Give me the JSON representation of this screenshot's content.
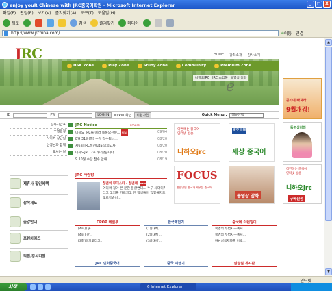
{
  "window": {
    "title": "enJoy youR Chinese with JRC중국어학원 - Microsoft Internet Explorer",
    "minimize": "_",
    "maximize": "□",
    "close": "X"
  },
  "menubar": {
    "items": [
      "파일(F)",
      "편집(E)",
      "보기(V)",
      "즐겨찾기(A)",
      "도구(T)",
      "도움말(H)"
    ]
  },
  "toolbar": {
    "back_label": "뒤로",
    "search_label": "검색",
    "favorites_label": "즐겨찾기",
    "media_label": "미디어"
  },
  "addressbar": {
    "url": "http://www.jrchina.com/",
    "go_label": "이동",
    "links_label": "연결"
  },
  "page": {
    "logo": {
      "j": "J",
      "rc": "RC",
      "sub": "JONGRO CHINA"
    },
    "toplinks": [
      "HOME",
      "강좌소개",
      "강사소개"
    ],
    "nav": [
      "HSK Zone",
      "Play Zone",
      "Study Zone",
      "Community",
      "Premium Zone"
    ],
    "subnav": [
      "니하오JRC",
      "JRC 소임풍",
      "동영상 강좌"
    ],
    "bigE": "e",
    "rightad1": {
      "line1": "공가에 빠져라!",
      "line2": "9월개강!"
    },
    "login": {
      "id_label": "ID",
      "pw_label": "PW",
      "log_label": "LOG",
      "in_label": "IN",
      "find_label": "ID/PW 확인",
      "join_label": "회원가입",
      "quick_label": "Quick Menu :",
      "quick_select": "메뉴선택"
    },
    "leftmenu": [
      "강좌시간표",
      "수업일정",
      "사이버 상담실",
      "선생님과 함께",
      "오시는 길"
    ],
    "sidebuttons": [
      "제휴사 할인혜택",
      "장학제도",
      "출강안내",
      "프렌차이즈",
      "직원/강사지원"
    ],
    "notice": {
      "title": "JRC Notice",
      "more": "+more",
      "new_label": "NEW",
      "items": [
        {
          "text": "니하오 JRC를 여러 동문으신분...",
          "date": "09/04"
        },
        {
          "text": "8월 31일(월) 수강 접수됩니...",
          "date": "08/20"
        },
        {
          "text": "제6회 JRC실천KBS 모의고사",
          "date": "08/20"
        },
        {
          "text": "니하오JRC 2호가나왔습니다...",
          "date": "08/20"
        },
        {
          "text": "9.10월 수강 접수 안내",
          "date": "08/19"
        }
      ]
    },
    "sarang": {
      "title": "JRC 사랑방",
      "post_title": "청년의 무대스타 - 천년에",
      "body": "여디써 정아 몬 문한 운글연대... 누구 사다미? 라고 고치를 가르치고 만 학생들이 있었을지도 모르겠습니...",
      "new_label": "new"
    },
    "ads": {
      "ad1_line1": "이번에는 중국어",
      "ad1_line2": "인터넷 방송",
      "ad1_big": "니하오jrc",
      "ad2_line1": "東亞日報",
      "ad2_big": "세상 중국어",
      "ad3_big": "FOCUS",
      "ad3_sub": "한민명인 한국과 배우는 중국어",
      "ad4_big": "동영상 강좌"
    },
    "rightad2": {
      "title": "동영상강좌"
    },
    "rightad3": {
      "line1": "이번에는 중국어",
      "line2": "인터넷 방송",
      "big": "니하오jrc",
      "btn": "구독신청"
    },
    "cpop": {
      "title": "CPOP 베일부",
      "items": [
        "[4회]] 꽃...",
        "[4회] 찬...",
        "[3회]동기로다고..."
      ]
    },
    "korean_drama": {
      "title": "한국체험기",
      "items": [
        "(1)[대체]...",
        "(2)[대체]...",
        "(3)[대체]..."
      ]
    },
    "china_news": {
      "title": "중국에 이런일이",
      "items": [
        "북경의 무법자—폭시...",
        "북경의 무법자—폭시...",
        "하남성곡제화를 이때..."
      ]
    },
    "bottom_headers": [
      "JRC 인화중국어",
      "중국 여행기",
      "삼삼실 게시판"
    ]
  },
  "statusbar": {
    "zone": "인터넷"
  },
  "taskbar": {
    "start": "시작",
    "ie_task": "6 Internet Explorer"
  }
}
